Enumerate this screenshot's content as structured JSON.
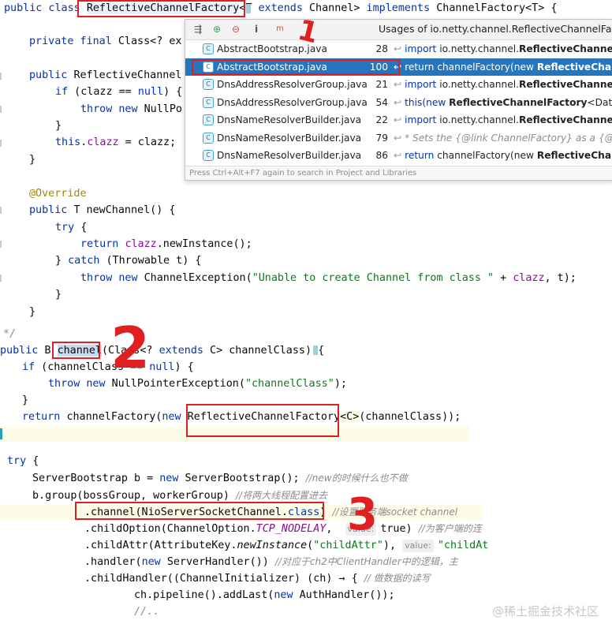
{
  "code": {
    "l1": {
      "a": "public class ",
      "b": "ReflectiveChannelFactory",
      "c": "<T ",
      "d": "extends",
      "e": " Channel> ",
      "f": "implements",
      "g": " ChannelFactory<T> {"
    },
    "l2": {
      "a": "private final ",
      "b": "Class<? ex"
    },
    "l3": {
      "a": "public ",
      "b": "ReflectiveChannel"
    },
    "l4": {
      "a": "if",
      "b": " (clazz == ",
      "c": "null",
      "d": ") {"
    },
    "l5": {
      "a": "throw new ",
      "b": "NullPo"
    },
    "l6": {
      "a": "}"
    },
    "l7": {
      "a": "this",
      "b": ".",
      "c": "clazz",
      "d": " = clazz;"
    },
    "l8": {
      "a": "}"
    },
    "l9": {
      "a": "@Override"
    },
    "l10": {
      "a": "public ",
      "b": "T newChannel() {"
    },
    "l11": {
      "a": "try",
      "b": " {"
    },
    "l12": {
      "a": "return ",
      "b": "clazz",
      "c": ".newInstance();"
    },
    "l13": {
      "a": "} ",
      "b": "catch",
      "c": " (Throwable t) {"
    },
    "l14": {
      "a": "throw new ",
      "b": "ChannelException(",
      "c": "\"Unable to create Channel from class \"",
      "d": " + ",
      "e": "clazz",
      "f": ", t);"
    },
    "l15": {
      "a": "}"
    },
    "l16": {
      "a": "}"
    },
    "l17": {
      "a": "*/"
    },
    "l18": {
      "a": "public ",
      "b": "B ",
      "c": "channel",
      "d": "(Class<? ",
      "e": "extends",
      "f": " C> channelClass) {"
    },
    "l19": {
      "a": "if",
      "b": " (channelClass == ",
      "c": "null",
      "d": ") {"
    },
    "l20": {
      "a": "throw new ",
      "b": "NullPointerException(",
      "c": "\"channelClass\"",
      "d": ");"
    },
    "l21": {
      "a": "}"
    },
    "l22": {
      "a": "return ",
      "b": "channelFactory(",
      "c": "new ",
      "d": "ReflectiveChannelFactory",
      "e": "<C>",
      "f": "(channelClass));"
    },
    "l23": {
      "a": "try",
      "b": " {"
    },
    "l24": {
      "a": "ServerBootstrap b = ",
      "b": "new ",
      "c": "ServerBootstrap(); ",
      "d": "//new的时候什么也不做"
    },
    "l25": {
      "a": "b.group(bossGroup, workerGroup) ",
      "b": "//将两大线程配置进去"
    },
    "l26": {
      "a": ".channel(NioServerSocketChannel.",
      "b": "class",
      "c": ") ",
      "d": "//设置服务端socket channel"
    },
    "l27": {
      "a": ".childOption(ChannelOption.",
      "b": "TCP_NODELAY",
      "c": ",  ",
      "d": "value:",
      "e": "true) ",
      "f": "//为客户端的连"
    },
    "l28": {
      "a": ".childAttr(AttributeKey.",
      "b": "newInstance",
      "c": "(",
      "d": "\"childAttr\"",
      "e": "), ",
      "f": "value:",
      "g": "\"childAt"
    },
    "l29": {
      "a": ".handler(",
      "b": "new ",
      "c": "ServerHandler()) ",
      "d": "//对应于ch2中ClientHandler中的逻辑，主"
    },
    "l30": {
      "a": ".childHandler((ChannelInitializer) (ch) → { ",
      "b": "// 做数据的读写"
    },
    "l31": {
      "a": "ch.pipeline().addLast(",
      "b": "new ",
      "c": "AuthHandler());"
    },
    "l32": {
      "a": "//.."
    }
  },
  "popup": {
    "title": "Usages of io.netty.channel.ReflectiveChannelFa",
    "tools": [
      "⇶",
      "⊕",
      "⊖",
      "i",
      "m"
    ],
    "rows": [
      {
        "file": "AbstractBootstrap.java",
        "line": "28",
        "k": "import ",
        "pre": "io.netty.channel.",
        "bold": "ReflectiveChannelFa",
        "post": ""
      },
      {
        "file": "AbstractBootstrap.java",
        "line": "100",
        "k": "return ",
        "pre": "channelFactory(new ",
        "bold": "ReflectiveChann",
        "post": ""
      },
      {
        "file": "DnsAddressResolverGroup.java",
        "line": "21",
        "k": "import ",
        "pre": "io.netty.channel.",
        "bold": "ReflectiveChannelF",
        "post": ""
      },
      {
        "file": "DnsAddressResolverGroup.java",
        "line": "54",
        "k": "this(",
        "pre": "new ",
        "bold": "ReflectiveChannelFactory",
        "post": "<Datagr"
      },
      {
        "file": "DnsNameResolverBuilder.java",
        "line": "22",
        "k": "import ",
        "pre": "io.netty.channel.",
        "bold": "ReflectiveChannelF",
        "post": ""
      },
      {
        "file": "DnsNameResolverBuilder.java",
        "line": "79",
        "k": "",
        "pre": "* Sets the {@link ChannelFactory} as a {@lin",
        "bold": "",
        "post": ""
      },
      {
        "file": "DnsNameResolverBuilder.java",
        "line": "86",
        "k": "return ",
        "pre": "channelFactory(new ",
        "bold": "ReflectiveChann",
        "post": ""
      }
    ],
    "footer": "Press Ctrl+Alt+F7 again to search in Project and Libraries"
  },
  "annotations": {
    "n1": "1",
    "n2": "2",
    "n3": "3"
  },
  "watermark": "@稀土掘金技术社区"
}
